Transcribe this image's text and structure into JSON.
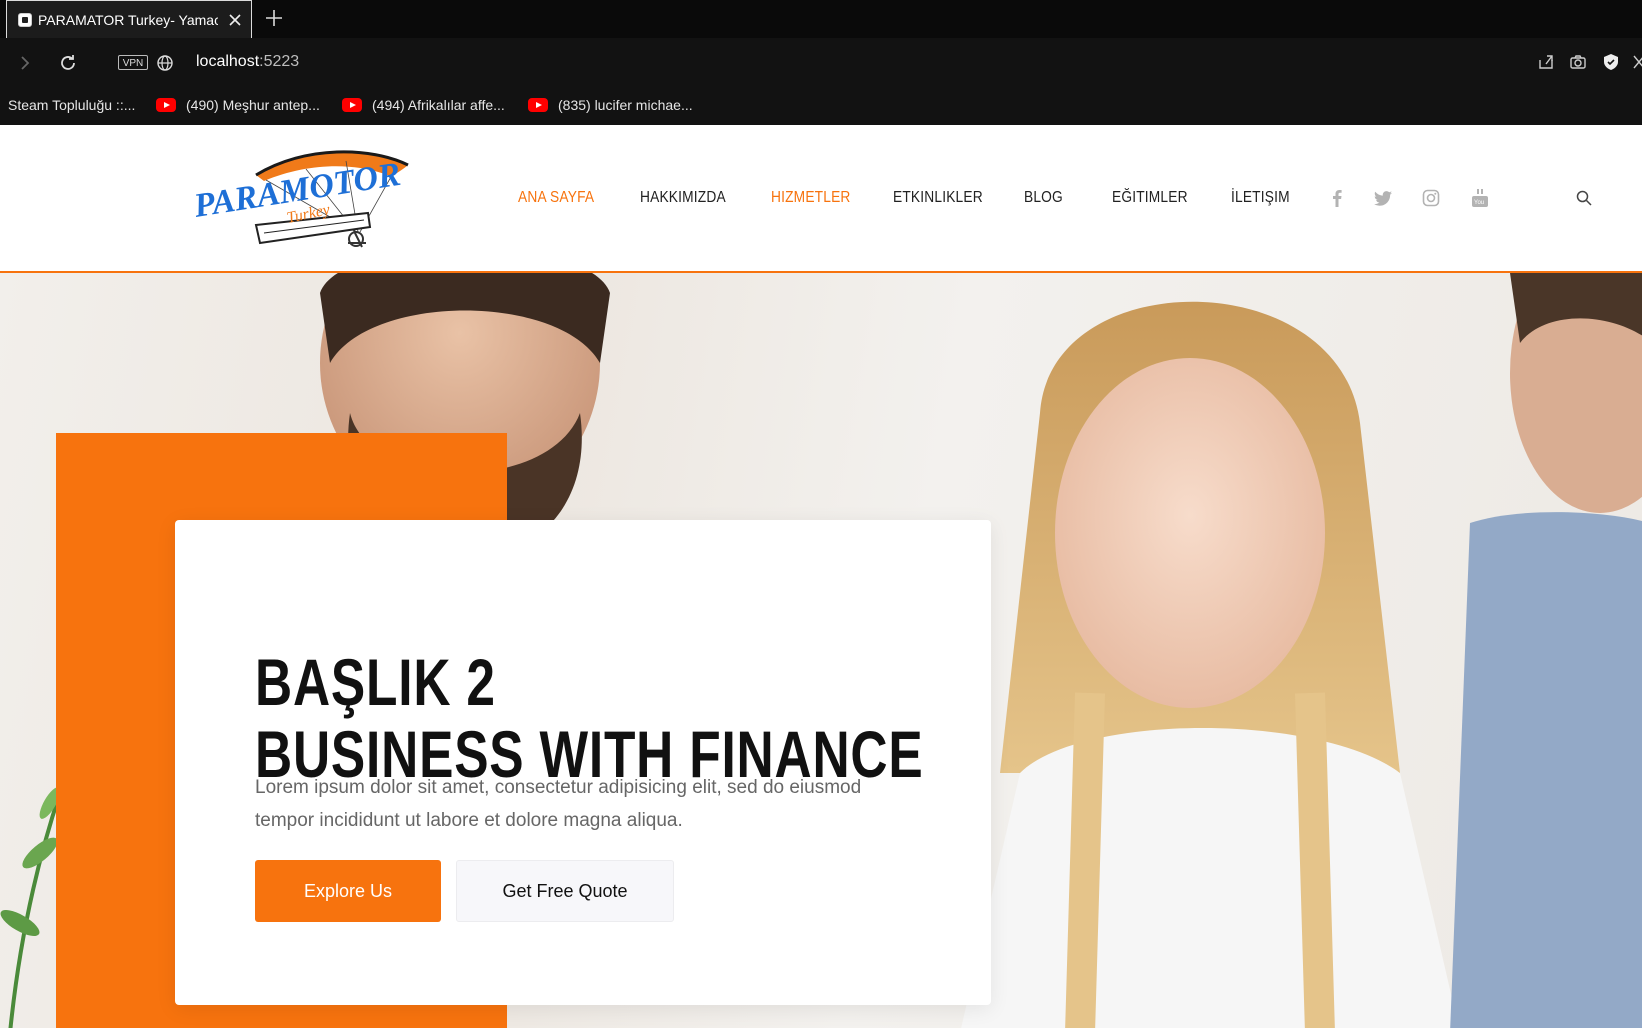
{
  "browser": {
    "tab_title": "PARAMATOR Turkey- Yamac",
    "url_host": "localhost",
    "url_port": ":5223",
    "vpn_label": "VPN",
    "bookmarks": [
      {
        "label": "Steam Topluluğu ::...",
        "icon": "none"
      },
      {
        "label": "(490) Meşhur antep...",
        "icon": "youtube-icon"
      },
      {
        "label": "(494) Afrikalılar affe...",
        "icon": "youtube-icon"
      },
      {
        "label": "(835) lucifer michae...",
        "icon": "youtube-icon"
      }
    ]
  },
  "header": {
    "logo_text": "PARAMOTOR",
    "logo_sub": "Turkey",
    "menu": [
      {
        "label": "ANA SAYFA",
        "active": true
      },
      {
        "label": "HAKKIMIZDA",
        "active": false
      },
      {
        "label": "HIZMETLER",
        "active": true
      },
      {
        "label": "ETKINLIKLER",
        "active": false
      },
      {
        "label": "BLOG",
        "active": false
      },
      {
        "label": "EĞITIMLER",
        "active": false
      },
      {
        "label": "İLETIŞIM",
        "active": false
      }
    ],
    "social": [
      "facebook-icon",
      "twitter-icon",
      "instagram-icon",
      "youtube-icon"
    ]
  },
  "hero": {
    "title_line1": "BAŞLIK 2",
    "title_line2": "BUSINESS WITH FINANCE",
    "description": "Lorem ipsum dolor sit amet, consectetur adipisicing elit, sed do eiusmod tempor incididunt ut labore et dolore magna aliqua.",
    "primary_button": "Explore Us",
    "secondary_button": "Get Free Quote"
  },
  "colors": {
    "accent": "#f7730e",
    "browser_bg": "#121212",
    "text_dark": "#111111"
  }
}
